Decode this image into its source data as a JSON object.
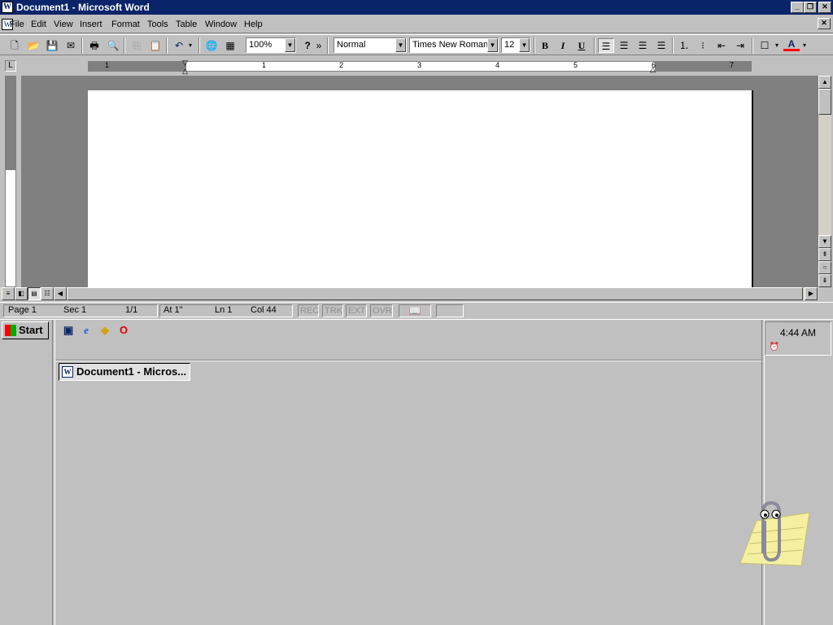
{
  "window": {
    "title": "Document1 - Microsoft Word",
    "app_icon": "W",
    "buttons": {
      "minimize": "_",
      "restore": "❐",
      "close": "✕"
    }
  },
  "menu": {
    "items": [
      "File",
      "Edit",
      "View",
      "Insert",
      "Format",
      "Tools",
      "Table",
      "Window",
      "Help"
    ],
    "doc_close": "✕"
  },
  "toolbar": {
    "zoom": "100%",
    "style": "Normal",
    "font": "Times New Roman",
    "size": "12",
    "bold": "B",
    "italic": "I",
    "underline": "U",
    "help": "?",
    "more": "»"
  },
  "ruler": {
    "tab_selector": "L",
    "numbers": [
      "1",
      "1",
      "2",
      "3",
      "4",
      "5",
      "6",
      "7"
    ]
  },
  "document": {
    "body_text": ""
  },
  "statusbar": {
    "page": "Page 1",
    "sec": "Sec 1",
    "pages": "1/1",
    "at": "At 1\"",
    "ln": "Ln 1",
    "col": "Col 44",
    "rec": "REC",
    "trk": "TRK",
    "ext": "EXT",
    "ovr": "OVR"
  },
  "taskbar": {
    "start": "Start",
    "task_button": "Document1 - Micros...",
    "clock": "4:44 AM",
    "quick_launch": [
      "desktop-icon",
      "internet-explorer-icon",
      "channels-icon",
      "opera-icon"
    ]
  },
  "colors": {
    "titlebar": "#0a246a",
    "face": "#c0c0c0",
    "font_color_bar": "#ff0000"
  }
}
